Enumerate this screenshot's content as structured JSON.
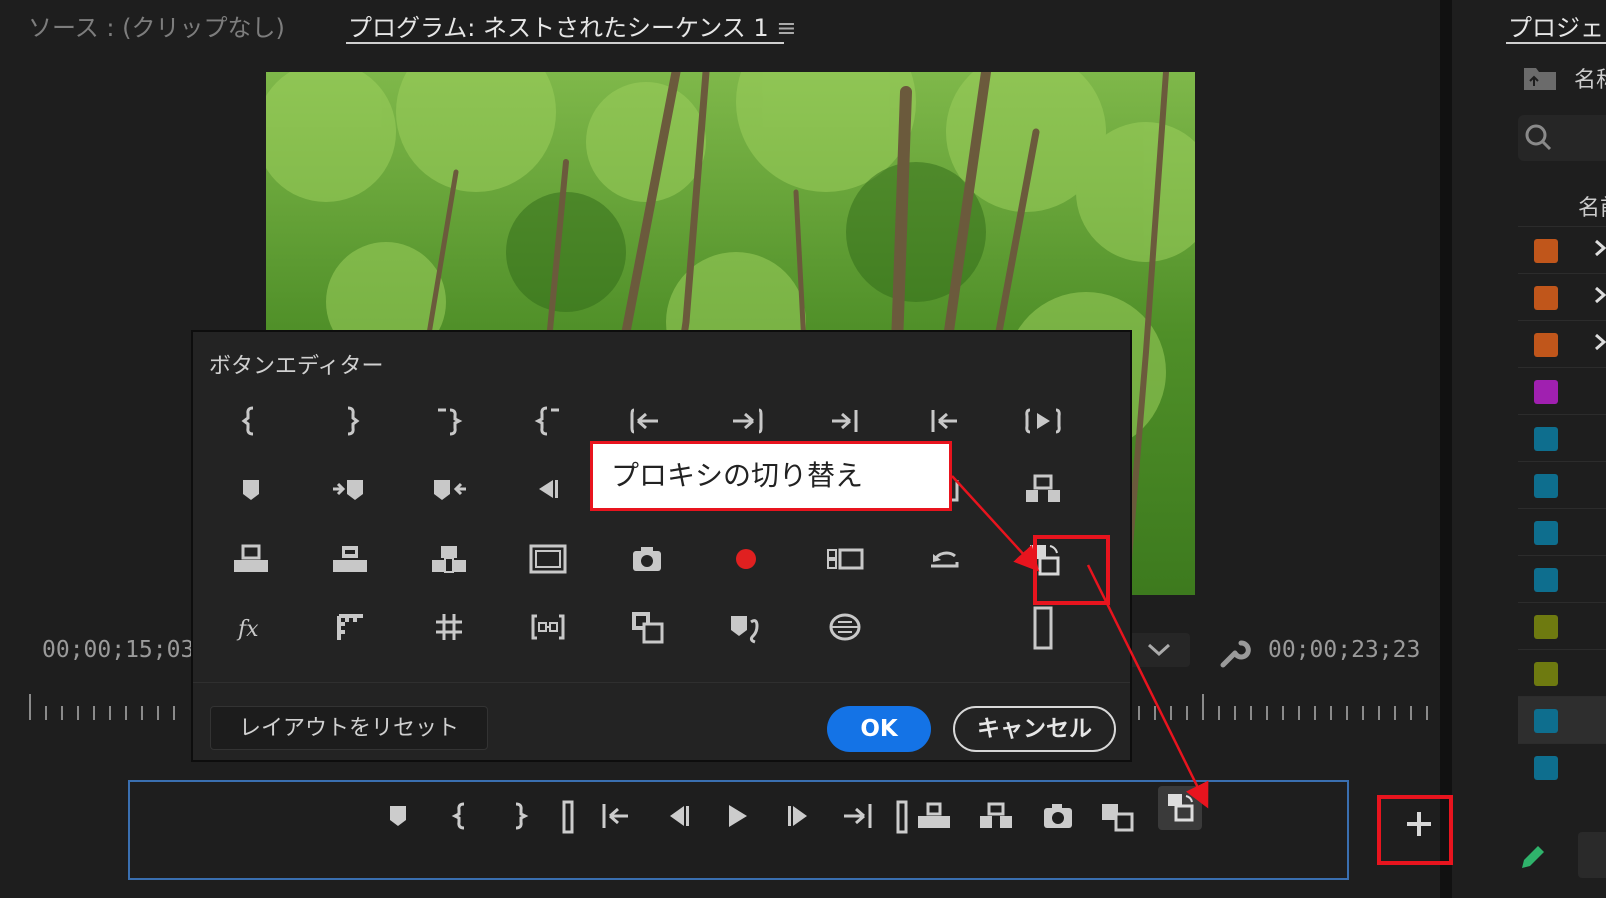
{
  "monitor": {
    "source_tab": "ソース : (クリップなし)",
    "program_tab": "プログラム: ネストされたシーケンス 1",
    "program_menu_icon": "≡",
    "timecode_in": "00;00;15;03",
    "timecode_out": "00;00;23;23"
  },
  "transport": {
    "buttons": [
      "marker-icon",
      "mark-in-icon",
      "mark-out-icon",
      "clear-in-out-icon",
      "go-to-in-icon",
      "step-back-icon",
      "play-icon",
      "step-forward-icon",
      "go-to-out-icon",
      "clear-icon",
      "lift-icon",
      "extract-icon",
      "camera-icon",
      "insert-icon",
      "toggle-proxy-icon"
    ],
    "add_icon": "add-icon",
    "add_label": "+"
  },
  "project": {
    "tab": "プロジェ",
    "col_name_1": "名称",
    "col_name_2": "名前",
    "rows": [
      {
        "color": "#c0561b",
        "expand": true
      },
      {
        "color": "#c0561b",
        "expand": true
      },
      {
        "color": "#c0561b",
        "expand": true
      },
      {
        "color": "#a020b0",
        "expand": false
      },
      {
        "color": "#0e6e8e",
        "expand": false
      },
      {
        "color": "#0e6e8e",
        "expand": false
      },
      {
        "color": "#0e6e8e",
        "expand": false
      },
      {
        "color": "#0e6e8e",
        "expand": false
      },
      {
        "color": "#6e7a10",
        "expand": false
      },
      {
        "color": "#6e7a10",
        "expand": false
      },
      {
        "color": "#0e6e8e",
        "expand": false
      },
      {
        "color": "#0e6e8e",
        "expand": false
      }
    ]
  },
  "editor": {
    "title": "ボタンエディター",
    "grid_buttons": [
      [
        "mark-in-icon",
        "mark-out-icon",
        "clear-in-icon",
        "clear-out-icon",
        "go-to-in-icon",
        "go-to-out-icon",
        "go-to-next-edit-icon",
        "go-to-prev-edit-icon",
        "play-in-to-out-icon"
      ],
      [
        "add-marker-icon",
        "go-to-next-marker-icon",
        "go-to-prev-marker-icon",
        "step-back-icon",
        "",
        "",
        "",
        "play-around-icon",
        "extract-icon"
      ],
      [
        "lift-icon",
        "overwrite-icon",
        "insert-icon",
        "safe-margins-icon",
        "export-frame-icon",
        "record-icon",
        "multi-camera-icon",
        "loop-icon",
        "toggle-proxy-icon"
      ],
      [
        "fx-icon",
        "comparison-view-icon",
        "transparency-grid-icon",
        "vr-icon",
        "insert-clip-icon",
        "mark-clip-icon",
        "global-fx-mute-icon",
        "",
        "spacer-icon"
      ]
    ],
    "reset_label": "レイアウトをリセット",
    "ok_label": "OK",
    "cancel_label": "キャンセル"
  },
  "annotation": {
    "callout_text": "プロキシの切り替え",
    "highlight_color": "#e8141e"
  }
}
